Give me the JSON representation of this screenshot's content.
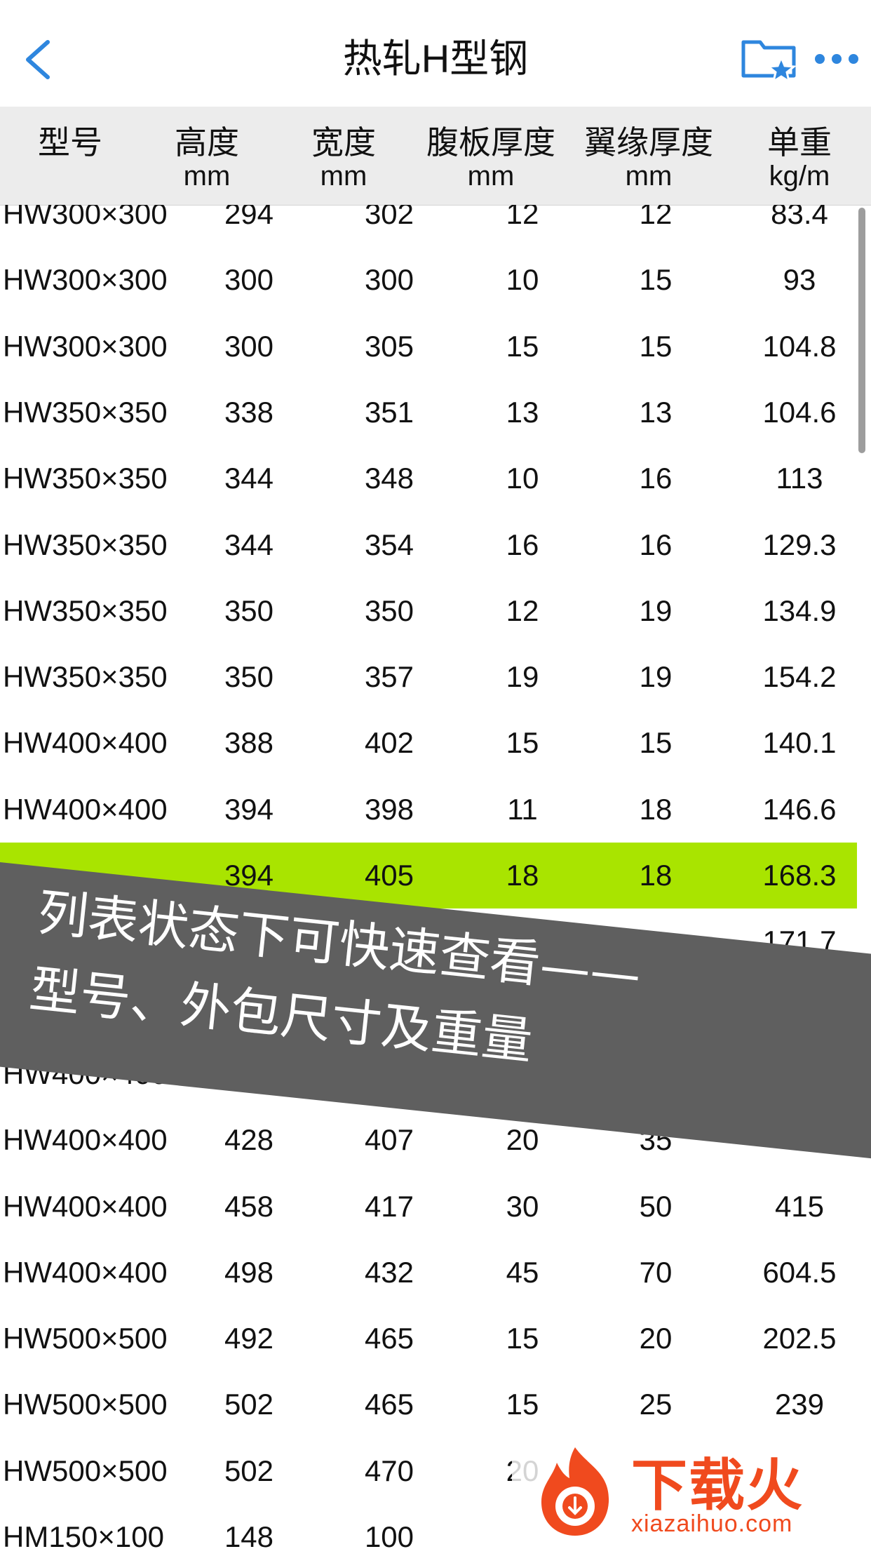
{
  "nav": {
    "title": "热轧H型钢",
    "back_icon": "back-chevron-icon",
    "favorites_icon": "folder-star-icon",
    "more_icon": "more-dots-icon",
    "accent_color": "#2e86de"
  },
  "table": {
    "headers": [
      {
        "label": "型号",
        "unit": ""
      },
      {
        "label": "高度",
        "unit": "mm"
      },
      {
        "label": "宽度",
        "unit": "mm"
      },
      {
        "label": "腹板厚度",
        "unit": "mm"
      },
      {
        "label": "翼缘厚度",
        "unit": "mm"
      },
      {
        "label": "单重",
        "unit": "kg/m"
      }
    ],
    "highlight_color": "#a9e400",
    "rows": [
      {
        "c": [
          "HW300×300",
          "294",
          "302",
          "12",
          "12",
          "83.4"
        ]
      },
      {
        "c": [
          "HW300×300",
          "300",
          "300",
          "10",
          "15",
          "93"
        ]
      },
      {
        "c": [
          "HW300×300",
          "300",
          "305",
          "15",
          "15",
          "104.8"
        ]
      },
      {
        "c": [
          "HW350×350",
          "338",
          "351",
          "13",
          "13",
          "104.6"
        ]
      },
      {
        "c": [
          "HW350×350",
          "344",
          "348",
          "10",
          "16",
          "113"
        ]
      },
      {
        "c": [
          "HW350×350",
          "344",
          "354",
          "16",
          "16",
          "129.3"
        ]
      },
      {
        "c": [
          "HW350×350",
          "350",
          "350",
          "12",
          "19",
          "134.9"
        ]
      },
      {
        "c": [
          "HW350×350",
          "350",
          "357",
          "19",
          "19",
          "154.2"
        ]
      },
      {
        "c": [
          "HW400×400",
          "388",
          "402",
          "15",
          "15",
          "140.1"
        ]
      },
      {
        "c": [
          "HW400×400",
          "394",
          "398",
          "11",
          "18",
          "146.6"
        ]
      },
      {
        "c": [
          "",
          "394",
          "405",
          "18",
          "18",
          "168.3"
        ],
        "highlighted": true
      },
      {
        "c": [
          "",
          "",
          "",
          "",
          "",
          "171.7"
        ]
      },
      {
        "c": [
          "",
          "",
          "",
          "",
          "",
          ""
        ]
      },
      {
        "c": [
          "HW400×400",
          "",
          "",
          "",
          "",
          ""
        ]
      },
      {
        "c": [
          "HW400×400",
          "428",
          "407",
          "20",
          "35",
          ""
        ]
      },
      {
        "c": [
          "HW400×400",
          "458",
          "417",
          "30",
          "50",
          "415"
        ]
      },
      {
        "c": [
          "HW400×400",
          "498",
          "432",
          "45",
          "70",
          "604.5"
        ]
      },
      {
        "c": [
          "HW500×500",
          "492",
          "465",
          "15",
          "20",
          "202.5"
        ]
      },
      {
        "c": [
          "HW500×500",
          "502",
          "465",
          "15",
          "25",
          "239"
        ]
      },
      {
        "c": [
          "HW500×500",
          "502",
          "470",
          "20",
          "",
          ""
        ]
      },
      {
        "c": [
          "HM150×100",
          "148",
          "100",
          "",
          "",
          ""
        ]
      }
    ]
  },
  "banner": {
    "line1": "列表状态下可快速查看——",
    "line2": "型号、外包尺寸及重量"
  },
  "watermark": {
    "name": "下载火",
    "domain": "xiazaihuo.com"
  }
}
